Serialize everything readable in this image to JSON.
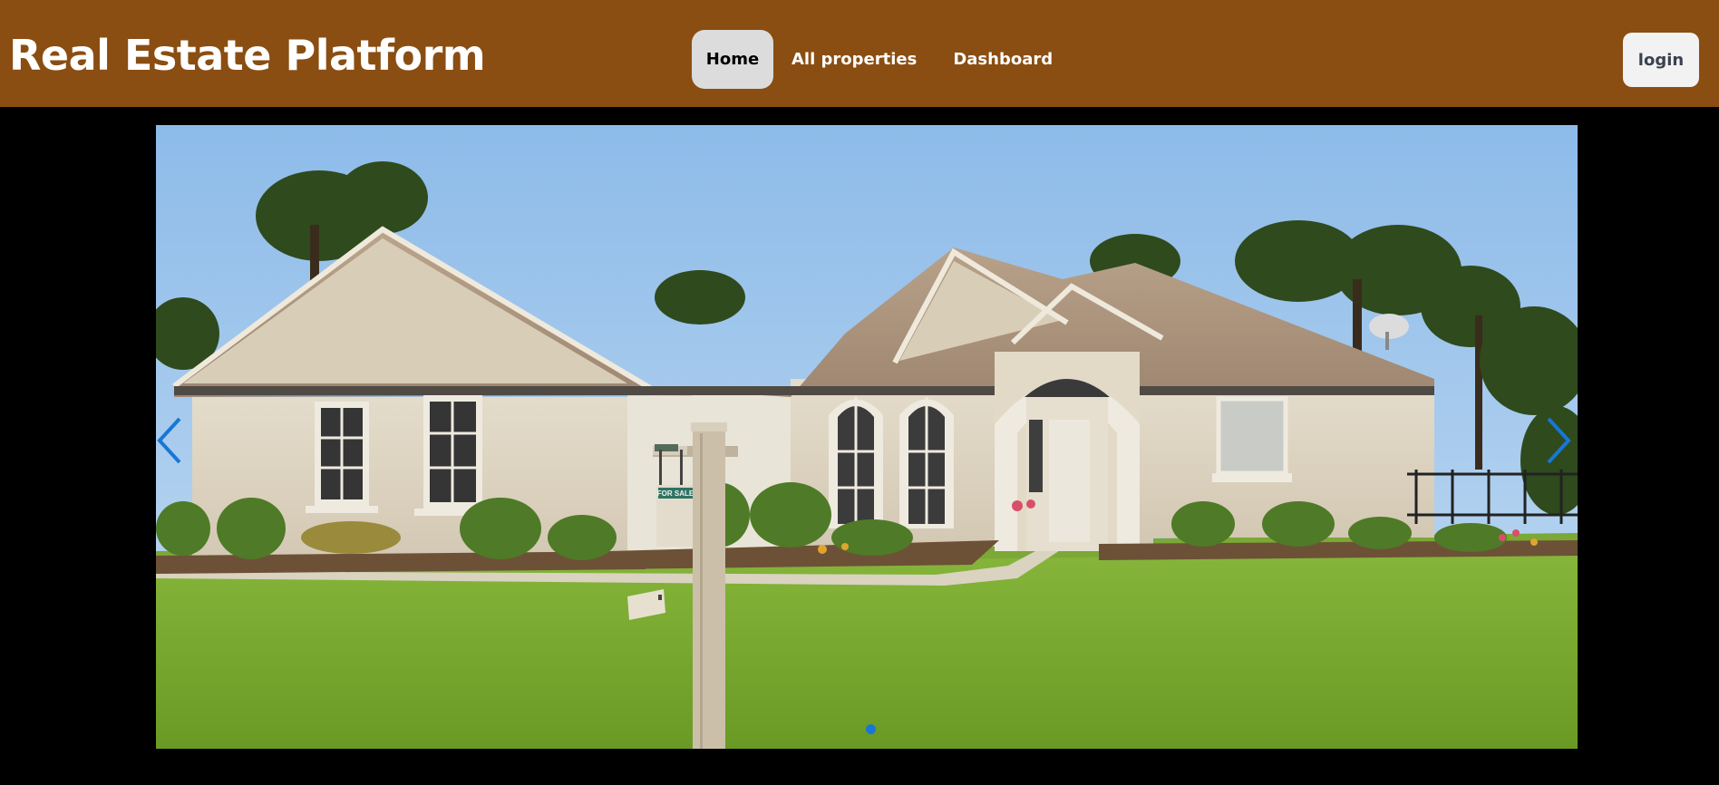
{
  "header": {
    "brand": "Real Estate Platform",
    "nav": [
      {
        "label": "Home",
        "active": true
      },
      {
        "label": "All properties",
        "active": false
      },
      {
        "label": "Dashboard",
        "active": false
      }
    ],
    "login_label": "login"
  },
  "carousel": {
    "slide_image": "house-for-sale-photo",
    "sign_text": "FOR SALE",
    "prev_icon": "chevron-left-icon",
    "next_icon": "chevron-right-icon",
    "active_indicator": 1,
    "indicator_count": 1
  },
  "colors": {
    "navbar_bg": "#8a4e12",
    "page_bg": "#000000",
    "active_tab_bg": "#dcdcdc",
    "accent": "#1877d6"
  }
}
